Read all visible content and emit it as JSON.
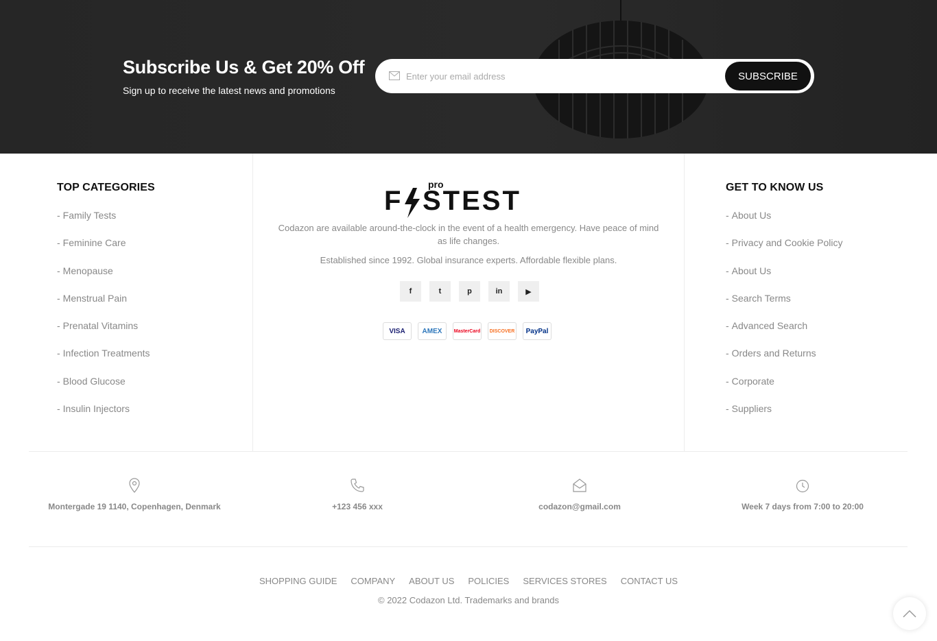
{
  "newsletter": {
    "title": "Subscribe Us & Get 20% Off",
    "subtitle": "Sign up to receive the latest news and promotions",
    "placeholder": "Enter your email address",
    "button": "SUBSCRIBE"
  },
  "top_categories": {
    "title": "TOP CATEGORIES",
    "items": [
      "Family Tests",
      "Feminine Care",
      "Menopause",
      "Menstrual Pain",
      "Prenatal Vitamins",
      "Infection Treatments",
      "Blood Glucose",
      "Insulin Injectors"
    ]
  },
  "brand": {
    "logo_small": "pro",
    "logo_text": "F STEST",
    "about": "Codazon are available around-the-clock in the event of a health emergency. Have peace of mind as life changes.",
    "established": "Established since 1992. Global insurance experts. Affordable flexible plans.",
    "socials": [
      {
        "icon": "facebook-icon",
        "glyph": "f"
      },
      {
        "icon": "twitter-icon",
        "glyph": "t"
      },
      {
        "icon": "pinterest-icon",
        "glyph": "p"
      },
      {
        "icon": "linkedin-icon",
        "glyph": "in"
      },
      {
        "icon": "youtube-icon",
        "glyph": "▶"
      }
    ],
    "payments": [
      "VISA",
      "AMEX",
      "MasterCard",
      "DISCOVER",
      "PayPal"
    ]
  },
  "get_to_know": {
    "title": "GET TO KNOW US",
    "items": [
      "About Us",
      "Privacy and Cookie Policy",
      "About Us",
      "Search Terms",
      "Advanced Search",
      "Orders and Returns",
      "Corporate",
      "Suppliers"
    ]
  },
  "contact": {
    "address": "Montergade 19 1140, Copenhagen, Denmark",
    "phone": "+123 456 xxx",
    "email": "codazon@gmail.com",
    "hours": "Week 7 days from 7:00 to 20:00"
  },
  "bottom_links": [
    "SHOPPING GUIDE",
    "COMPANY",
    "ABOUT US",
    "POLICIES",
    "SERVICES STORES",
    "CONTACT US"
  ],
  "copyright": "© 2022 Codazon Ltd. Trademarks and brands",
  "colors": {
    "dark": "#111111",
    "muted": "#888888",
    "banner": "#262626"
  }
}
